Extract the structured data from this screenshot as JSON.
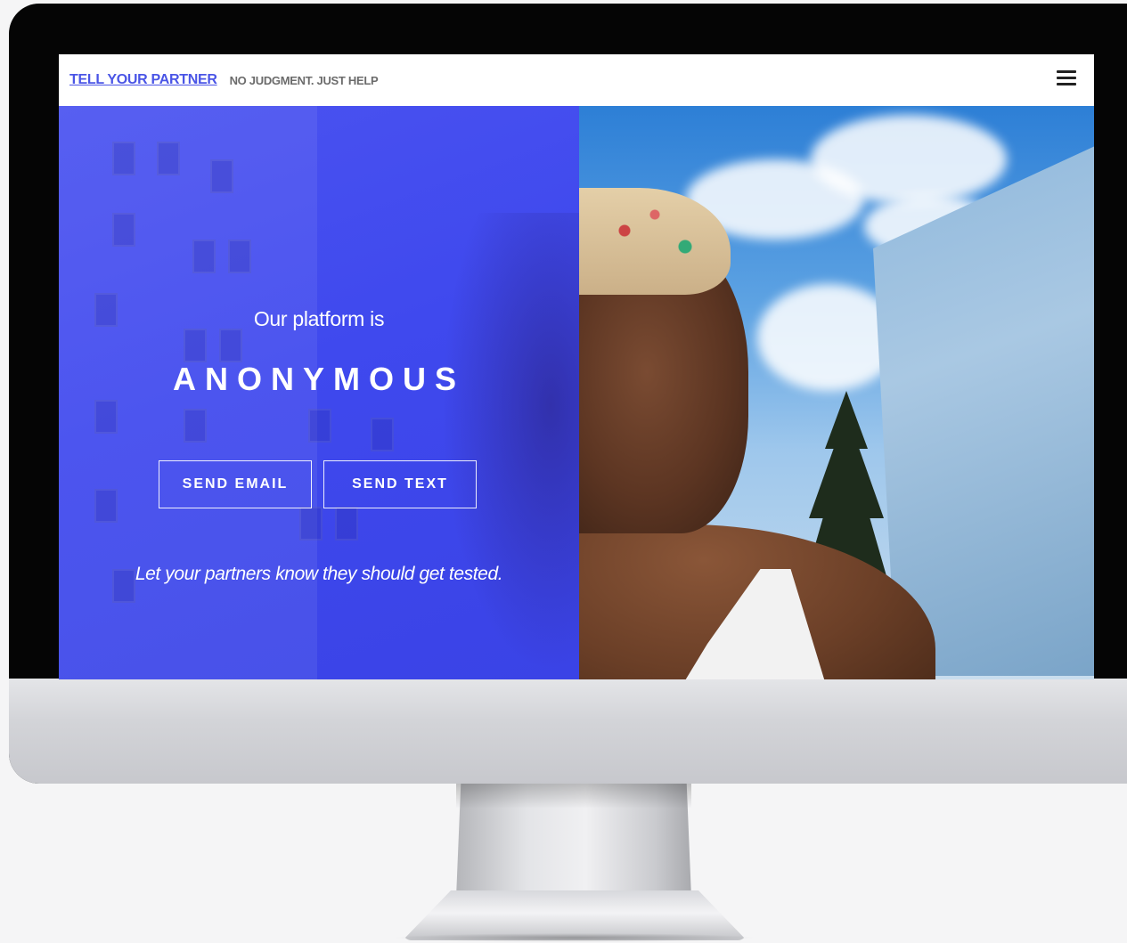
{
  "navbar": {
    "brand": "TELL YOUR PARTNER",
    "tagline": "NO JUDGMENT. JUST HELP",
    "menu_icon": "hamburger-menu-icon"
  },
  "hero": {
    "lead": "Our platform is",
    "headline": "ANONYMOUS",
    "buttons": {
      "email": "SEND EMAIL",
      "text": "SEND TEXT"
    },
    "subtext": "Let your partners know they should get tested.",
    "overlay_color": "#4450f0"
  },
  "colors": {
    "brand": "#4a55e6",
    "tagline": "#6b6b6b",
    "bezel": "#050505"
  }
}
